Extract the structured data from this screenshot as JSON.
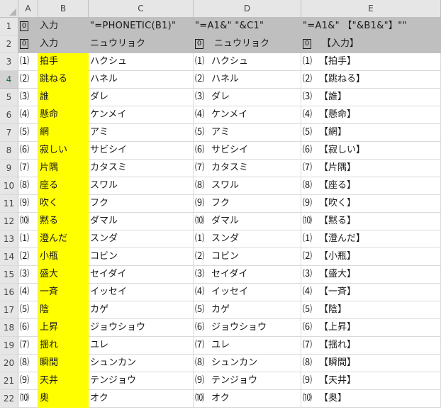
{
  "column_headers": [
    "A",
    "B",
    "C",
    "D",
    "E"
  ],
  "row1": {
    "a": "0",
    "b": "入力",
    "c": "\"=PHONETIC(B1)\"",
    "d": "\"=A1&\"   \"&C1\"",
    "e": "\"=A1&\"   【\"&B1&\"】\"\""
  },
  "row2": {
    "a": "0",
    "b": "入力",
    "c": "ニュウリョク",
    "d_num": "0",
    "d_text": "ニュウリョク",
    "e_num": "0",
    "e_text": "【入力】"
  },
  "rows": [
    {
      "row": "3",
      "num": "⑴",
      "b": "拍手",
      "c": "ハクシュ",
      "e": "【拍手】"
    },
    {
      "row": "4",
      "num": "⑵",
      "b": "跳ねる",
      "c": "ハネル",
      "e": "【跳ねる】"
    },
    {
      "row": "5",
      "num": "⑶",
      "b": "誰",
      "c": "ダレ",
      "e": "【誰】"
    },
    {
      "row": "6",
      "num": "⑷",
      "b": "懸命",
      "c": "ケンメイ",
      "e": "【懸命】"
    },
    {
      "row": "7",
      "num": "⑸",
      "b": "網",
      "c": "アミ",
      "e": "【網】"
    },
    {
      "row": "8",
      "num": "⑹",
      "b": "寂しい",
      "c": "サビシイ",
      "e": "【寂しい】"
    },
    {
      "row": "9",
      "num": "⑺",
      "b": "片隅",
      "c": "カタスミ",
      "e": "【片隅】"
    },
    {
      "row": "10",
      "num": "⑻",
      "b": "座る",
      "c": "スワル",
      "e": "【座る】"
    },
    {
      "row": "11",
      "num": "⑼",
      "b": "吹く",
      "c": "フク",
      "e": "【吹く】"
    },
    {
      "row": "12",
      "num": "⑽",
      "b": "黙る",
      "c": "ダマル",
      "e": "【黙る】"
    },
    {
      "row": "13",
      "num": "⑴",
      "b": "澄んだ",
      "c": "スンダ",
      "e": "【澄んだ】"
    },
    {
      "row": "14",
      "num": "⑵",
      "b": "小瓶",
      "c": "コビン",
      "e": "【小瓶】"
    },
    {
      "row": "15",
      "num": "⑶",
      "b": "盛大",
      "c": "セイダイ",
      "e": "【盛大】"
    },
    {
      "row": "16",
      "num": "⑷",
      "b": "一斉",
      "c": "イッセイ",
      "e": "【一斉】"
    },
    {
      "row": "17",
      "num": "⑸",
      "b": "陰",
      "c": "カゲ",
      "e": "【陰】"
    },
    {
      "row": "18",
      "num": "⑹",
      "b": "上昇",
      "c": "ジョウショウ",
      "e": "【上昇】"
    },
    {
      "row": "19",
      "num": "⑺",
      "b": "揺れ",
      "c": "ユレ",
      "e": "【揺れ】"
    },
    {
      "row": "20",
      "num": "⑻",
      "b": "瞬間",
      "c": "シュンカン",
      "e": "【瞬間】"
    },
    {
      "row": "21",
      "num": "⑼",
      "b": "天井",
      "c": "テンジョウ",
      "e": "【天井】"
    },
    {
      "row": "22",
      "num": "⑽",
      "b": "奥",
      "c": "オク",
      "e": "【奥】"
    }
  ],
  "selected_row": "4"
}
